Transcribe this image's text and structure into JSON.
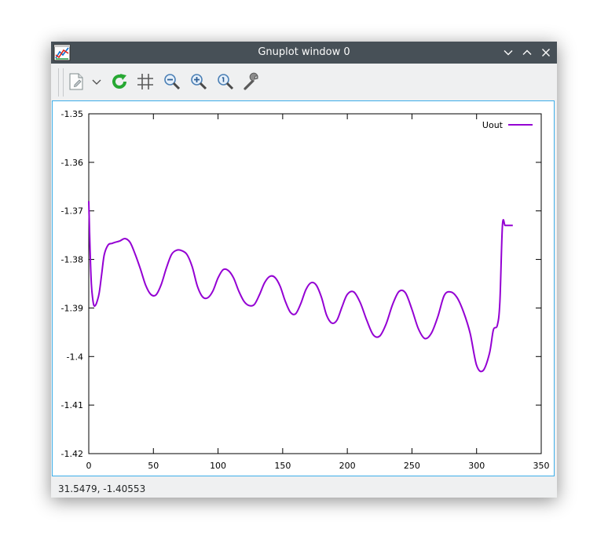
{
  "window": {
    "title": "Gnuplot window 0"
  },
  "toolbar": {
    "buttons": [
      {
        "icon": "export-icon"
      },
      {
        "icon": "chevron-down-icon"
      },
      {
        "icon": "replot-icon"
      },
      {
        "icon": "grid-icon"
      },
      {
        "icon": "zoom-out-icon"
      },
      {
        "icon": "zoom-in-icon"
      },
      {
        "icon": "zoom-fit-icon"
      },
      {
        "icon": "settings-wrench-icon"
      }
    ]
  },
  "status": {
    "coordinates": "31.5479, -1.40553"
  },
  "chart_data": {
    "type": "line",
    "title": "",
    "xlabel": "",
    "ylabel": "",
    "xlim": [
      0,
      350
    ],
    "ylim": [
      -1.42,
      -1.35
    ],
    "x_ticks": [
      "0",
      "50",
      "100",
      "150",
      "200",
      "250",
      "300",
      "350"
    ],
    "y_ticks": [
      "-1.35",
      "-1.36",
      "-1.37",
      "-1.38",
      "-1.39",
      "-1.4",
      "-1.41",
      "-1.42"
    ],
    "legend_position": "top-right",
    "grid": false,
    "series": [
      {
        "name": "Uout",
        "color": "#9400d3",
        "x": [
          0,
          1,
          2,
          3,
          4,
          5,
          6,
          8,
          10,
          12,
          15,
          18,
          20,
          24,
          28,
          32,
          36,
          40,
          44,
          48,
          52,
          56,
          60,
          64,
          68,
          72,
          76,
          80,
          84,
          88,
          92,
          96,
          100,
          104,
          108,
          112,
          116,
          120,
          124,
          128,
          132,
          136,
          140,
          144,
          148,
          152,
          156,
          160,
          164,
          168,
          172,
          176,
          180,
          184,
          188,
          192,
          196,
          200,
          205,
          210,
          215,
          220,
          225,
          230,
          235,
          240,
          245,
          250,
          255,
          260,
          265,
          270,
          275,
          280,
          285,
          290,
          295,
          300,
          305,
          310,
          313,
          316,
          318,
          320,
          322,
          324,
          326,
          327,
          327.5,
          328
        ],
        "y": [
          -1.368,
          -1.378,
          -1.385,
          -1.388,
          -1.3895,
          -1.3895,
          -1.389,
          -1.387,
          -1.383,
          -1.379,
          -1.377,
          -1.3767,
          -1.3765,
          -1.3762,
          -1.3757,
          -1.3765,
          -1.379,
          -1.382,
          -1.3853,
          -1.3872,
          -1.3873,
          -1.3852,
          -1.3818,
          -1.379,
          -1.3781,
          -1.3782,
          -1.379,
          -1.3815,
          -1.3855,
          -1.3877,
          -1.3879,
          -1.3865,
          -1.3838,
          -1.3821,
          -1.3823,
          -1.3838,
          -1.3865,
          -1.3886,
          -1.3895,
          -1.3893,
          -1.3873,
          -1.3848,
          -1.3835,
          -1.3837,
          -1.3855,
          -1.3886,
          -1.3909,
          -1.3912,
          -1.3891,
          -1.3862,
          -1.3848,
          -1.3853,
          -1.3878,
          -1.3915,
          -1.3931,
          -1.3925,
          -1.3897,
          -1.3872,
          -1.3867,
          -1.3889,
          -1.3925,
          -1.3955,
          -1.3958,
          -1.3933,
          -1.3893,
          -1.3866,
          -1.3869,
          -1.3903,
          -1.3943,
          -1.3963,
          -1.3952,
          -1.3918,
          -1.3874,
          -1.3867,
          -1.3879,
          -1.3909,
          -1.3952,
          -1.4018,
          -1.4029,
          -1.3993,
          -1.3945,
          -1.3936,
          -1.3888,
          -1.373,
          -1.373,
          -1.373,
          -1.373,
          -1.373,
          -1.373,
          -1.373
        ]
      }
    ]
  }
}
